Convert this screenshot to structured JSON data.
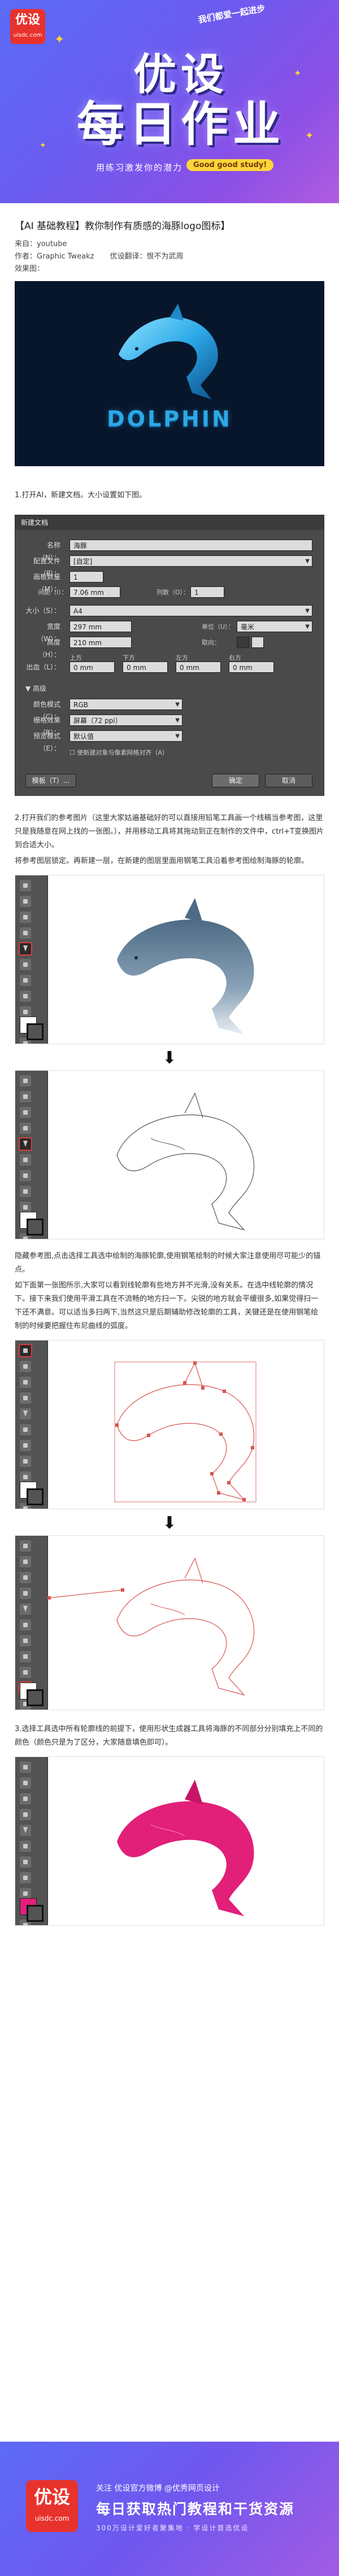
{
  "banner": {
    "logo_cn": "优设",
    "logo_en": "uisdc.com",
    "ribbon": "我们都爱一起进步",
    "title_line1": "优设",
    "title_line2": "每日作业",
    "slogan": "用练习激发你的潜力",
    "pill": "Good good study!"
  },
  "article": {
    "title": "【AI 基础教程】教你制作有质感的海豚logo图标】",
    "source": "来自：youtube",
    "author": "作者：Graphic Tweakz",
    "translator": "优设翻译：恨不为武周",
    "preview": "效果图：",
    "hero_word": "DOLPHIN",
    "step1": "1.打开AI，新建文档。大小设置如下图。",
    "step2": "2.打开我们的参考图片（这里大家姑遍基础好的可以直接用铅笔工具画一个线稿当参考图，这里只是我随意在网上找的一张图。），并用移动工具将其拖动到正在制作的文件中，ctrl+T变换图片到合适大小。",
    "step2b": "将参考图层锁定。再新建一层，在新建的图层里面用钢笔工具沿着参考图绘制海豚的轮廓。",
    "step3a": "隐藏参考图,点击选择工具选中绘制的海豚轮廓,使用钢笔绘制的时候大家注意使用尽可能少的锚点。",
    "step3b": "如下面第一张图所示,大家可以看到线轮廓有些地方并不光滑,没有关系。在选中线轮廓的情况下。接下来我们使用平滑工具在不流畅的地方扫一下。尖锐的地方就会平缓很多,如果觉得扫一下还不满意。可以适当多扫两下,当然这只是后期辅助修改轮廓的工具，关键还是在使用钢笔绘制的时候要把握住布尼曲线的弧度。",
    "step4": "3.选择工具选中所有轮廓线的前提下，使用形状生成器工具将海豚的不同部分分别填充上不同的颜色（颜色只是为了区分，大家随意填色即可）。"
  },
  "dialog": {
    "title": "新建文档",
    "name_label": "名称（N）：",
    "name_value": "海豚",
    "profile_label": "配置文件（P）：",
    "profile_value": "[自定]",
    "artboards_label": "画板数量（M）：",
    "artboards_value": "1",
    "spacing_label": "间距（I）：",
    "spacing_value": "7.06 mm",
    "columns_label": "列数（O）：",
    "columns_value": "1",
    "size_label": "大小（S）：",
    "size_value": "A4",
    "width_label": "宽度（W）：",
    "width_value": "297 mm",
    "units_label": "单位（U）：",
    "units_value": "毫米",
    "height_label": "高度（H）：",
    "height_value": "210 mm",
    "orientation_label": "取向：",
    "bleed_label": "出血（L）：",
    "bleed_top_label": "上方",
    "bleed_bottom_label": "下方",
    "bleed_left_label": "左方",
    "bleed_right_label": "右方",
    "bleed_value": "0 mm",
    "advanced_label": "高级",
    "color_mode_label": "颜色模式（C）：",
    "color_mode_value": "RGB",
    "raster_label": "栅格效果（R）：",
    "raster_value": "屏幕（72 ppi）",
    "preview_label": "预览模式（E）：",
    "preview_value": "默认值",
    "align_pixel_label": "使新建对象与像素网格对齐（A）",
    "template_btn": "模板（T）...",
    "ok_btn": "确定",
    "cancel_btn": "取消"
  },
  "footer": {
    "logo_cn": "优设",
    "logo_en": "uisdc.com",
    "line1": "关注 优设官方微博 @优秀网页设计",
    "line2": "每日获取热门教程和干货资源",
    "line3": "300万设计爱好者聚集地 · 学设计首选优设"
  },
  "colors": {
    "banner_start": "#5b6bf5",
    "banner_end": "#b05ce0",
    "logo_red": "#e8322c",
    "dolphin_blue": "#2ca8e8",
    "dolphin_pink": "#e21f79",
    "path_red": "#d9534f"
  }
}
